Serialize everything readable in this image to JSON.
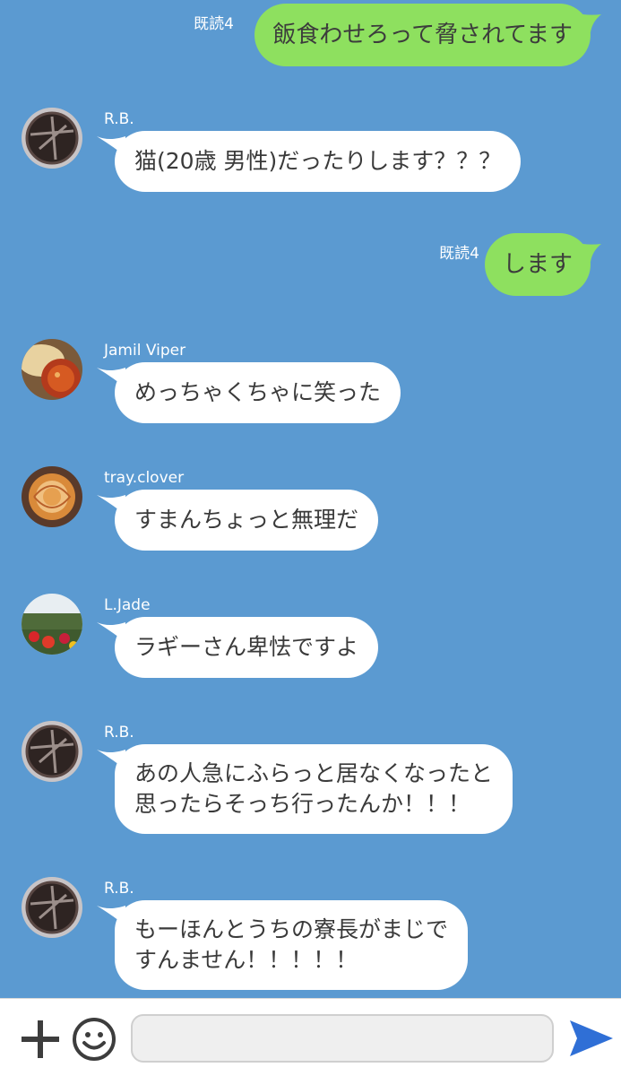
{
  "messages_sent": [
    {
      "read_receipt": "既読4",
      "text": "飯食わせろって脅されてます"
    },
    {
      "read_receipt": "既読4",
      "text": "します"
    }
  ],
  "messages_received": [
    {
      "sender": "R.B.",
      "avatar": "chocolate-tart-avatar",
      "lines": [
        "猫(20歳 男性)だったりします？？？"
      ]
    },
    {
      "sender": "Jamil Viper",
      "avatar": "curry-bread-avatar",
      "lines": [
        "めっちゃくちゃに笑った"
      ]
    },
    {
      "sender": "tray.clover",
      "avatar": "apple-rose-tart-avatar",
      "lines": [
        "すまんちょっと無理だ"
      ]
    },
    {
      "sender": "L.Jade",
      "avatar": "flower-field-avatar",
      "lines": [
        "ラギーさん卑怯ですよ"
      ]
    },
    {
      "sender": "R.B.",
      "avatar": "chocolate-tart-avatar",
      "lines": [
        "あの人急にふらっと居なくなったと",
        "思ったらそっち行ったんか！！！"
      ]
    },
    {
      "sender": "R.B.",
      "avatar": "chocolate-tart-avatar",
      "lines": [
        "もーほんとうちの寮長がまじで",
        "すんません！！！！！"
      ]
    }
  ],
  "input_bar": {
    "plus_icon": "plus-icon",
    "emoji_icon": "smiley-icon",
    "message_value": "",
    "send_icon": "send-arrow-icon"
  },
  "colors": {
    "background": "#5b9ad1",
    "sent_bubble": "#8ee05f",
    "received_bubble": "#ffffff",
    "send_arrow": "#2f6fd6"
  }
}
